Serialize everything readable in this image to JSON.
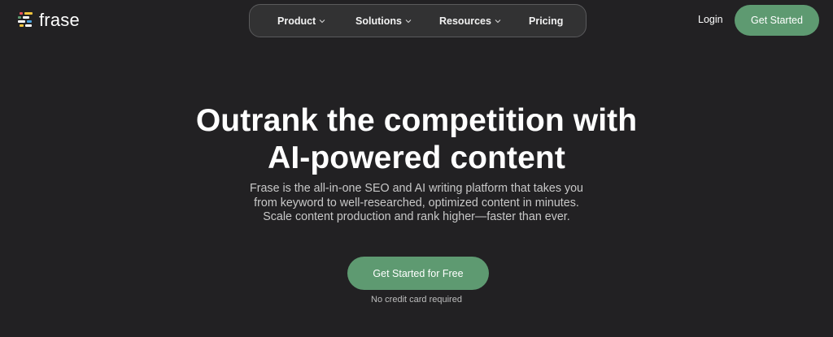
{
  "header": {
    "logo_text": "frase",
    "nav": {
      "product": "Product",
      "solutions": "Solutions",
      "resources": "Resources",
      "pricing": "Pricing"
    },
    "login": "Login",
    "cta": "Get Started"
  },
  "hero": {
    "title_line1": "Outrank the competition with",
    "title_line2": "AI-powered content",
    "sub_line1": "Frase is the all-in-one SEO and AI writing platform that takes you",
    "sub_line2": "from keyword to well-researched, optimized content in minutes.",
    "sub_line3": "Scale content production and rank higher—faster than ever.",
    "cta": "Get Started for Free",
    "note": "No credit card required"
  },
  "colors": {
    "background": "#222123",
    "nav_background": "#323233",
    "accent": "#5e9a71"
  },
  "icons": {
    "logo": "frase-logo-icon",
    "dropdown": "chevron-down-icon"
  }
}
